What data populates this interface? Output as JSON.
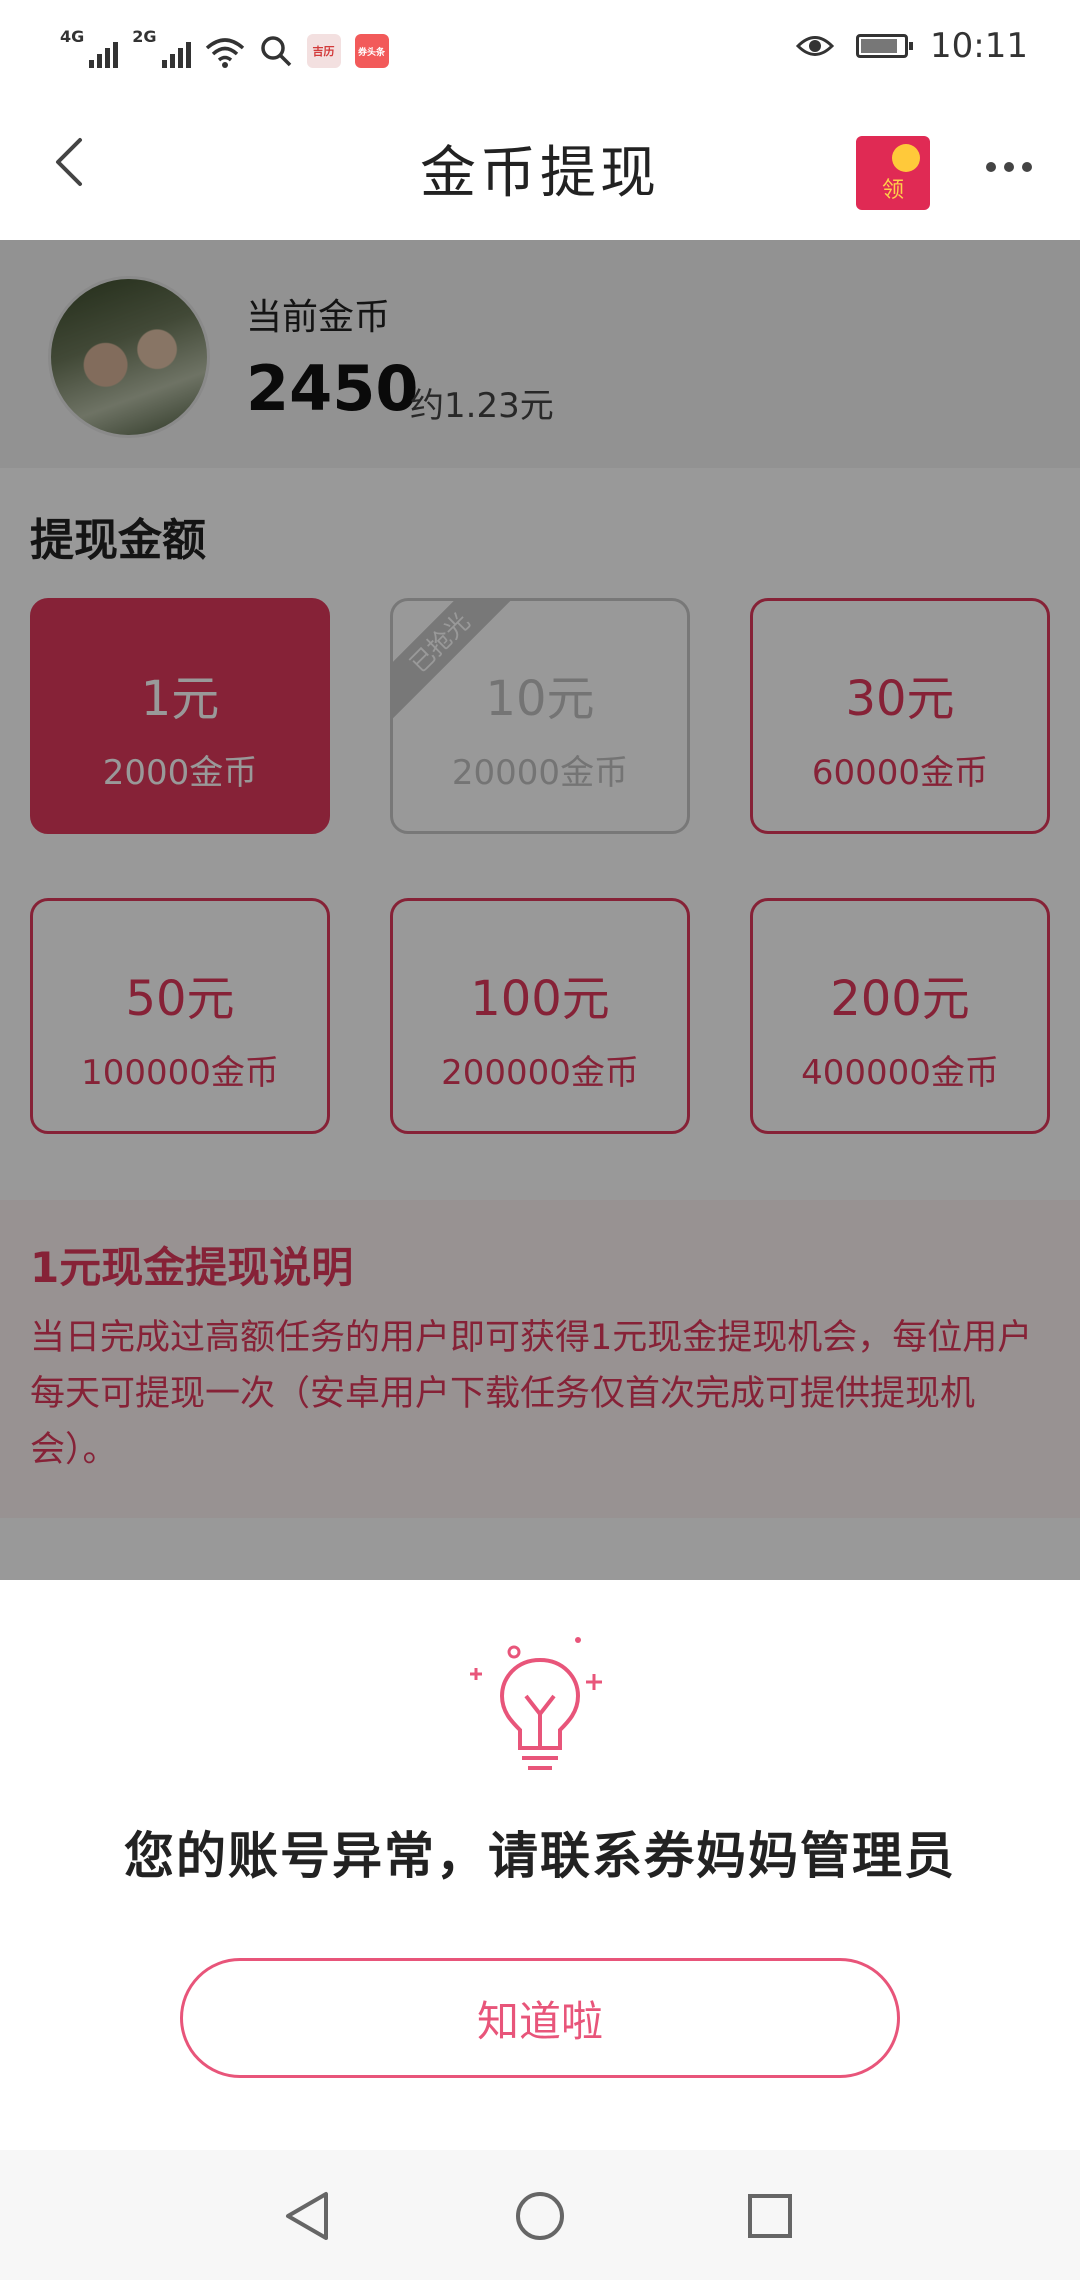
{
  "status_bar": {
    "network_1": "4G",
    "network_2": "2G",
    "app_badge_1": "吉历",
    "app_badge_2": "券头条",
    "time": "10:11"
  },
  "header": {
    "title": "金币提现",
    "redpacket_label": "领"
  },
  "account": {
    "coins_label": "当前金币",
    "coins_value": "2450",
    "coins_approx": "约1.23元"
  },
  "withdraw": {
    "section_title": "提现金额",
    "sold_out_tag": "已抢光",
    "options": [
      {
        "amount": "1元",
        "cost": "2000金币",
        "state": "selected"
      },
      {
        "amount": "10元",
        "cost": "20000金币",
        "state": "sold_out"
      },
      {
        "amount": "30元",
        "cost": "60000金币",
        "state": "normal"
      },
      {
        "amount": "50元",
        "cost": "100000金币",
        "state": "normal"
      },
      {
        "amount": "100元",
        "cost": "200000金币",
        "state": "normal"
      },
      {
        "amount": "200元",
        "cost": "400000金币",
        "state": "normal"
      }
    ]
  },
  "notice": {
    "title": "1元现金提现说明",
    "text": "当日完成过高额任务的用户即可获得1元现金提现机会，每位用户每天可提现一次（安卓用户下载任务仅首次完成可提供提现机会）。"
  },
  "dialog": {
    "message": "您的账号异常，请联系券妈妈管理员",
    "button_label": "知道啦"
  },
  "colors": {
    "accent": "#e03a5d",
    "dialog_accent": "#e8557a",
    "redpacket": "#e02a54"
  }
}
